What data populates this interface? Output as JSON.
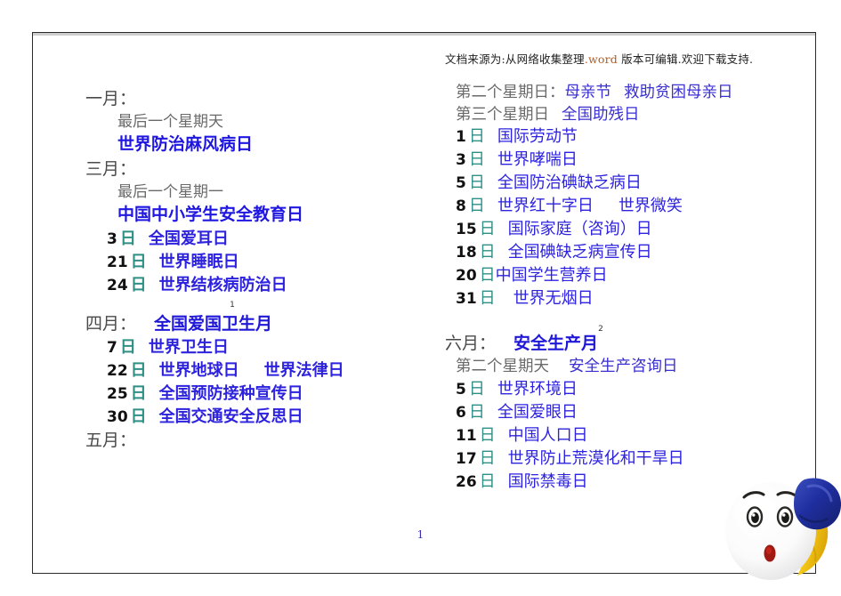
{
  "source_note": {
    "prefix": "文档来源为:从网络收集整理",
    "word_token": ".word",
    "suffix": " 版本可编辑.欢迎下载支持."
  },
  "page_number": "1",
  "colors": {
    "event_blue": "#2d22dd",
    "day_unit_teal": "#2f8f86",
    "month_grey": "#4a4a4a",
    "rule_grey": "#6a6a6a",
    "word_token": "#b35a1f",
    "border": "#2a2a2a"
  },
  "left_column": {
    "january": {
      "month_label": "一月：",
      "rule_line": "最后一个星期天",
      "big_event": "世界防治麻风病日"
    },
    "march": {
      "month_label": "三月：",
      "rule_line": "最后一个星期一",
      "big_event": "中国中小学生安全教育日",
      "rows": [
        {
          "day": "3",
          "unit": "日",
          "event": "全国爱耳日"
        },
        {
          "day": "21",
          "unit": "日",
          "event": "世界睡眠日"
        },
        {
          "day": "24",
          "unit": "日",
          "event": "世界结核病防治日"
        }
      ]
    },
    "footnote_marker_1": "1",
    "april": {
      "month_label": "四月：",
      "month_event": "全国爱国卫生月",
      "rows": [
        {
          "day": "7",
          "unit": "日",
          "event": "世界卫生日",
          "event2": ""
        },
        {
          "day": "22",
          "unit": "日",
          "event": "世界地球日",
          "event2": "世界法律日"
        },
        {
          "day": "25",
          "unit": "日",
          "event": "全国预防接种宣传日",
          "event2": ""
        },
        {
          "day": "30",
          "unit": "日",
          "event": "全国交通安全反思日",
          "event2": ""
        }
      ]
    },
    "may": {
      "month_label": "五月："
    }
  },
  "right_column": {
    "may_continued": {
      "rule_lines": [
        {
          "rule": "第二个星期日：",
          "event": "母亲节",
          "event2": "救助贫困母亲日"
        },
        {
          "rule": "第三个星期日",
          "event": "全国助残日",
          "event2": ""
        }
      ],
      "rows": [
        {
          "day": "1",
          "unit": "日",
          "event": "国际劳动节",
          "event2": ""
        },
        {
          "day": "3",
          "unit": "日",
          "event": "世界哮喘日",
          "event2": ""
        },
        {
          "day": "5",
          "unit": "日",
          "event": "全国防治碘缺乏病日",
          "event2": ""
        },
        {
          "day": "8",
          "unit": "日",
          "event": "世界红十字日",
          "event2": "世界微笑"
        },
        {
          "day": "15",
          "unit": "日",
          "event": "国际家庭（咨询）日",
          "event2": ""
        },
        {
          "day": "18",
          "unit": "日",
          "event": "全国碘缺乏病宣传日",
          "event2": ""
        },
        {
          "day": "20",
          "unit": "日",
          "event": "中国学生营养日",
          "event2": ""
        },
        {
          "day": "31",
          "unit": "日",
          "event": "世界无烟日",
          "event2": ""
        }
      ]
    },
    "footnote_marker_2": "2",
    "june": {
      "month_label": "六月：",
      "month_event": "安全生产月",
      "rule_line": "第二个星期天",
      "rule_event": "安全生产咨询日",
      "rows": [
        {
          "day": "5",
          "unit": "日",
          "event": "世界环境日",
          "event2": ""
        },
        {
          "day": "6",
          "unit": "日",
          "event": "全国爱眼日",
          "event2": ""
        },
        {
          "day": "11",
          "unit": "日",
          "event": "中国人口日",
          "event2": ""
        },
        {
          "day": "17",
          "unit": "日",
          "event": "世界防止荒漠化和干旱日",
          "event2": ""
        },
        {
          "day": "26",
          "unit": "日",
          "event": "国际禁毒日",
          "event2": ""
        }
      ]
    }
  },
  "mascot": {
    "name": "surprised-egg-character-with-boxing-glove"
  }
}
